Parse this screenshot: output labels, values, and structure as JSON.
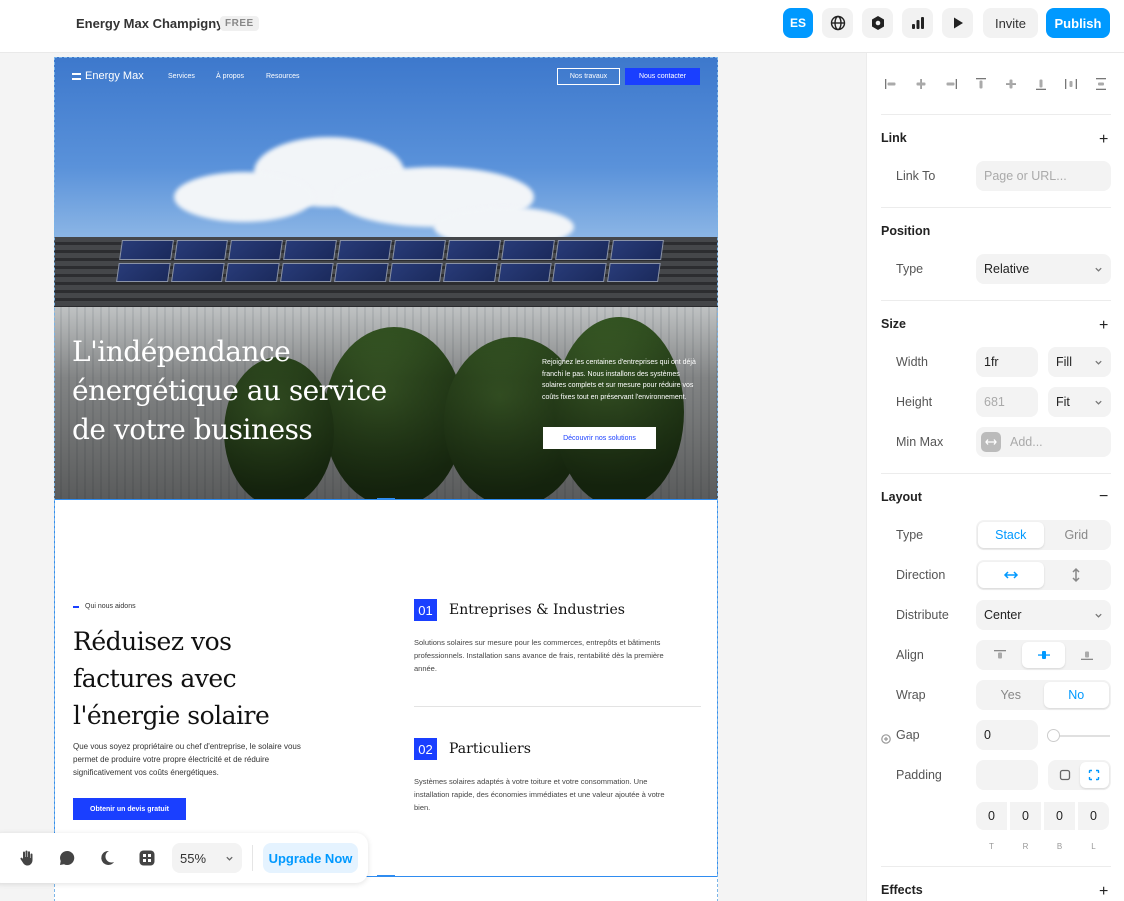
{
  "app": {
    "project_title": "Energy Max Champigny",
    "plan_badge": "FREE",
    "lang_button": "ES",
    "invite_label": "Invite",
    "publish_label": "Publish",
    "accent_color": "#0099ff"
  },
  "site": {
    "logo_text": "Energy Max",
    "nav": [
      "Services",
      "À propos",
      "Resources"
    ],
    "btn_works": "Nos travaux",
    "btn_contact": "Nous contacter",
    "hero_title": "L'indépendance énergétique au service de votre business",
    "hero_desc": "Rejoignez les centaines d'entreprises qui ont déjà franchi le pas. Nous installons des systèmes solaires complets et sur mesure pour réduire vos coûts fixes tout en préservant l'environnement.",
    "btn_discover": "Découvrir nos solutions",
    "brand_color": "#1a3fff",
    "section": {
      "eyebrow": "Qui nous aidons",
      "title": "Réduisez vos factures avec l'énergie solaire",
      "desc": "Que vous soyez propriétaire ou chef d'entreprise, le solaire vous permet de produire votre propre électricité et de réduire significativement vos coûts énergétiques.",
      "btn_quote": "Obtenir un devis gratuit",
      "services": [
        {
          "num": "01",
          "title": "Entreprises & Industries",
          "desc": "Solutions solaires sur mesure pour les commerces, entrepôts et bâtiments professionnels. Installation sans avance de frais, rentabilité dès la première année."
        },
        {
          "num": "02",
          "title": "Particuliers",
          "desc": "Systèmes solaires adaptés à votre toiture et votre consommation. Une installation rapide, des économies immédiates et une valeur ajoutée à votre bien."
        }
      ]
    }
  },
  "toolbar": {
    "zoom": "55%",
    "upgrade_label": "Upgrade Now",
    "tools": [
      "hand-tool-icon",
      "comment-icon",
      "dark-mode-icon",
      "components-icon"
    ]
  },
  "panel": {
    "link": {
      "title": "Link",
      "link_to_label": "Link To",
      "link_to_placeholder": "Page or URL..."
    },
    "position": {
      "title": "Position",
      "type_label": "Type",
      "type_value": "Relative"
    },
    "size": {
      "title": "Size",
      "width_label": "Width",
      "width_value": "1fr",
      "width_mode": "Fill",
      "height_label": "Height",
      "height_value": "681",
      "height_mode": "Fit",
      "minmax_label": "Min Max",
      "minmax_placeholder": "Add..."
    },
    "layout": {
      "title": "Layout",
      "type_label": "Type",
      "type_options": [
        "Stack",
        "Grid"
      ],
      "type_selected": "Stack",
      "direction_label": "Direction",
      "distribute_label": "Distribute",
      "distribute_value": "Center",
      "align_label": "Align",
      "wrap_label": "Wrap",
      "wrap_options": [
        "Yes",
        "No"
      ],
      "wrap_selected": "No",
      "gap_label": "Gap",
      "gap_value": "0",
      "padding_label": "Padding",
      "padding_values": [
        "0",
        "0",
        "0",
        "0"
      ],
      "padding_sides": [
        "T",
        "R",
        "B",
        "L"
      ]
    },
    "effects": {
      "title": "Effects"
    }
  }
}
